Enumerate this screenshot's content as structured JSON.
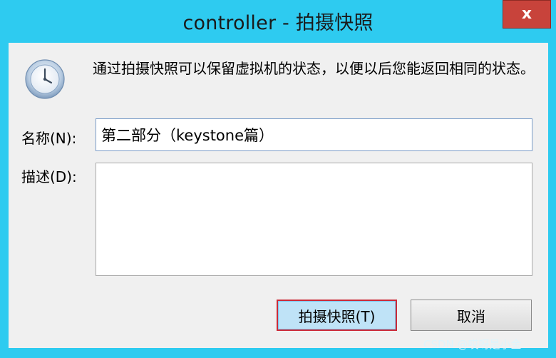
{
  "window": {
    "title": "controller - 拍摄快照",
    "close_label": "x"
  },
  "dialog": {
    "description": "通过拍摄快照可以保留虚拟机的状态，以便以后您能返回相同的状态。",
    "name_label": "名称(N):",
    "name_value": "第二部分（keystone篇）",
    "description_label": "描述(D):",
    "description_value": "",
    "take_snapshot_button": "拍摄快照(T)",
    "cancel_button": "取消"
  },
  "watermark": "CSDN @哎呀是小金",
  "icons": {
    "dialog_icon": "clock-icon",
    "close_icon": "close-icon"
  },
  "colors": {
    "titlebar": "#2ecbf0",
    "close_button": "#c8433b",
    "dialog_background": "#f0f0f0",
    "primary_button": "#bfe3f7",
    "primary_focus_border": "#cc2a38"
  }
}
